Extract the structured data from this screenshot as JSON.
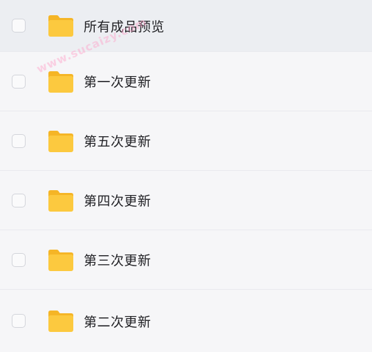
{
  "watermark": "www.sucaizy.com",
  "items": [
    {
      "name": "所有成品预览"
    },
    {
      "name": "第一次更新"
    },
    {
      "name": "第五次更新"
    },
    {
      "name": "第四次更新"
    },
    {
      "name": "第三次更新"
    },
    {
      "name": "第二次更新"
    }
  ],
  "colors": {
    "folder_main": "#fcc93f",
    "folder_back": "#f5b526",
    "row_highlight": "#eceef2",
    "background": "#f6f6f8"
  },
  "icons": {
    "folder": "folder-icon",
    "checkbox": "checkbox-unchecked"
  }
}
